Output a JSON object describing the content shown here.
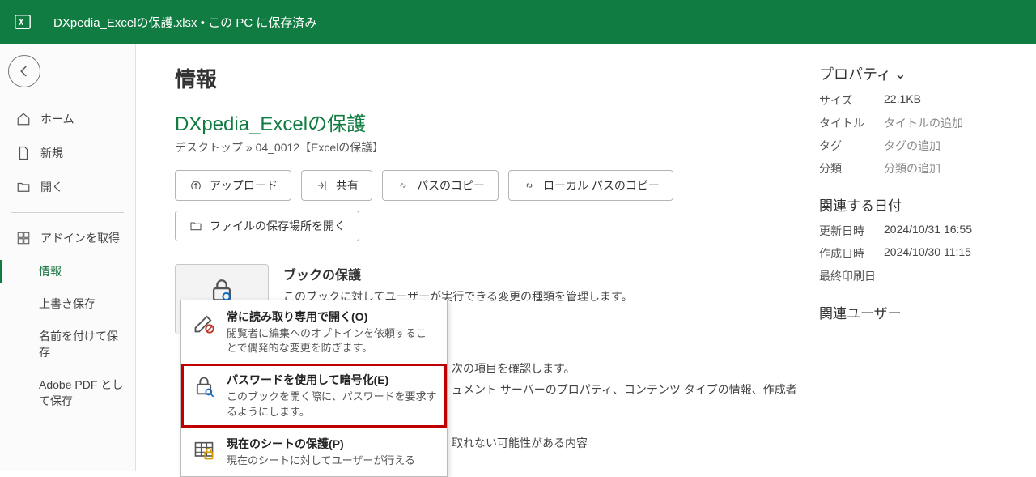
{
  "titlebar": {
    "filename": "DXpedia_Excelの保護.xlsx",
    "status": "この PC に保存済み"
  },
  "sidebar": {
    "home": "ホーム",
    "new": "新規",
    "open": "開く",
    "getaddins": "アドインを取得",
    "info": "情報",
    "save": "上書き保存",
    "saveas": "名前を付けて保存",
    "adobepdf": "Adobe PDF として保存"
  },
  "main": {
    "page_title": "情報",
    "doc_title": "DXpedia_Excelの保護",
    "doc_path": "デスクトップ » 04_0012【Excelの保護】",
    "actions": {
      "upload": "アップロード",
      "share": "共有",
      "copypath": "パスのコピー",
      "copylocalpath": "ローカル パスのコピー",
      "openlocation": "ファイルの保存場所を開く"
    },
    "protect": {
      "button": "ブックの保護",
      "heading": "ブックの保護",
      "desc": "このブックに対してユーザーが実行できる変更の種類を管理します。"
    },
    "behind": {
      "l1": "次の項目を確認します。",
      "l2": "ュメント サーバーのプロパティ、コンテンツ タイプの情報、作成者",
      "l3": "取れない可能性がある内容"
    },
    "dropdown": {
      "readonly": {
        "title_pre": "常に読み取り専用で開く(",
        "key": "O",
        "title_post": ")",
        "desc": "閲覧者に編集へのオプトインを依頼することで偶発的な変更を防ぎます。"
      },
      "encrypt": {
        "title_pre": "パスワードを使用して暗号化(",
        "key": "E",
        "title_post": ")",
        "desc": "このブックを開く際に、パスワードを要求するようにします。"
      },
      "sheet": {
        "title_pre": "現在のシートの保護(",
        "key": "P",
        "title_post": ")",
        "desc": "現在のシートに対してユーザーが行える"
      }
    }
  },
  "props": {
    "heading": "プロパティ",
    "rows": {
      "size": {
        "k": "サイズ",
        "v": "22.1KB"
      },
      "title": {
        "k": "タイトル",
        "v": "タイトルの追加"
      },
      "tags": {
        "k": "タグ",
        "v": "タグの追加"
      },
      "category": {
        "k": "分類",
        "v": "分類の追加"
      }
    },
    "dates_heading": "関連する日付",
    "dates": {
      "modified": {
        "k": "更新日時",
        "v": "2024/10/31 16:55"
      },
      "created": {
        "k": "作成日時",
        "v": "2024/10/30 11:15"
      },
      "printed": {
        "k": "最終印刷日",
        "v": ""
      }
    },
    "users_heading": "関連ユーザー"
  }
}
